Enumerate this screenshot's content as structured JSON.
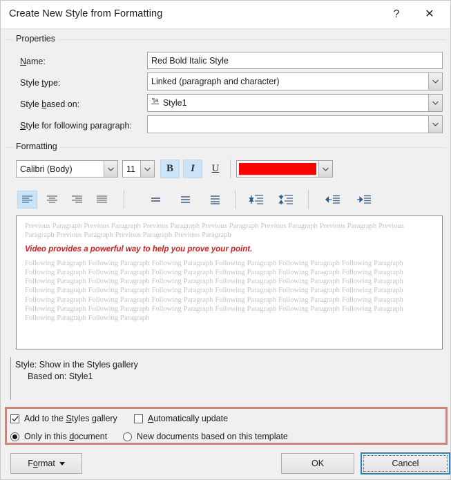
{
  "window": {
    "title": "Create New Style from Formatting",
    "help_glyph": "?",
    "close_glyph": "✕"
  },
  "properties": {
    "group_label": "Properties",
    "name_label": "Name:",
    "name_value": "Red Bold Italic Style",
    "style_type_label": "Style type:",
    "style_type_value": "Linked (paragraph and character)",
    "style_based_on_label": "Style based on:",
    "style_based_on_value": "Style1",
    "style_based_on_icon": "¶a",
    "style_following_label": "Style for following paragraph:",
    "style_following_value": ""
  },
  "formatting": {
    "group_label": "Formatting",
    "font_name": "Calibri (Body)",
    "font_size": "11",
    "bold_label": "B",
    "italic_label": "I",
    "underline_label": "U",
    "font_color_hex": "#ff0000",
    "bold_active": true,
    "italic_active": true,
    "underline_active": false,
    "align_left_active": true,
    "highlight_color_hex": "#e8796b",
    "accent_blue_hex": "#cce4f7"
  },
  "preview": {
    "previous_paragraph": "Previous Paragraph Previous Paragraph Previous Paragraph Previous Paragraph Previous Paragraph Previous Paragraph Previous Paragraph Previous Paragraph Previous Paragraph Previous Paragraph",
    "sample_text": "Video provides a powerful way to help you prove your point.",
    "following_paragraph": "Following Paragraph Following Paragraph Following Paragraph Following Paragraph Following Paragraph Following Paragraph Following Paragraph Following Paragraph Following Paragraph Following Paragraph Following Paragraph Following Paragraph Following Paragraph Following Paragraph Following Paragraph Following Paragraph Following Paragraph Following Paragraph Following Paragraph Following Paragraph Following Paragraph Following Paragraph Following Paragraph Following Paragraph Following Paragraph Following Paragraph Following Paragraph Following Paragraph Following Paragraph Following Paragraph Following Paragraph Following Paragraph Following Paragraph Following Paragraph Following Paragraph Following Paragraph Following Paragraph Following Paragraph"
  },
  "description": {
    "line1": "Style: Show in the Styles gallery",
    "line2": "Based on: Style1"
  },
  "options": {
    "add_to_gallery_label": "Add to the Styles gallery",
    "add_to_gallery_checked": true,
    "auto_update_label": "Automatically update",
    "auto_update_checked": false,
    "only_this_document_label": "Only in this document",
    "only_this_document_selected": true,
    "new_documents_label": "New documents based on this template",
    "new_documents_selected": false
  },
  "buttons": {
    "format_label": "Format",
    "ok_label": "OK",
    "cancel_label": "Cancel"
  }
}
